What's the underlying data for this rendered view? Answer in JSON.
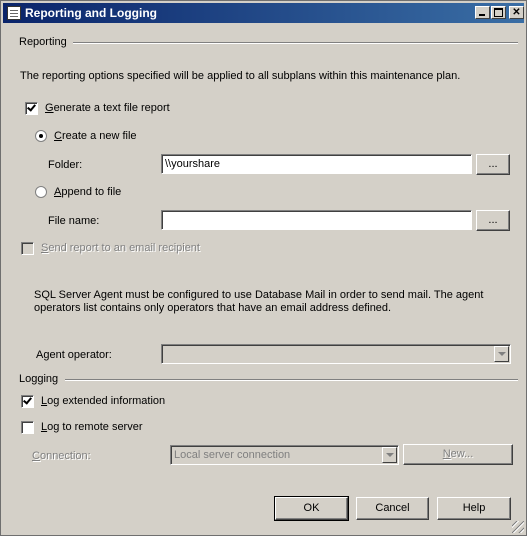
{
  "window": {
    "title": "Reporting and Logging"
  },
  "reporting": {
    "group_label": "Reporting",
    "description": "The reporting options specified will be applied to all subplans within this maintenance plan.",
    "generate_text_report": {
      "label_prefix": "",
      "accel": "G",
      "label_rest": "enerate a text file report",
      "checked": true
    },
    "create_new_file": {
      "accel": "C",
      "label_rest": "reate a new file",
      "selected": true
    },
    "folder": {
      "label": "Folder:",
      "value": "\\\\yourshare",
      "browse": "..."
    },
    "append_to_file": {
      "accel": "A",
      "label_rest": "ppend to file",
      "selected": false
    },
    "file_name": {
      "label": "File name:",
      "value": "",
      "browse": "..."
    },
    "email": {
      "accel": "S",
      "label_rest": "end report to an email recipient",
      "checked": false,
      "enabled": false
    },
    "mail_note_line1": "SQL Server Agent must be configured to use Database Mail in order to send mail. The agent",
    "mail_note_line2": "operators list contains only operators that have an email address defined.",
    "agent_operator": {
      "label": "Agent operator:",
      "value": ""
    }
  },
  "logging": {
    "group_label": "Logging",
    "extended": {
      "accel": "L",
      "label_rest": "og extended information",
      "checked": true
    },
    "remote": {
      "accel": "L",
      "label_rest": "og to remote server",
      "checked": false
    },
    "connection": {
      "accel": "C",
      "label_rest": "onnection:",
      "value": "Local server connection",
      "new_accel": "N",
      "new_rest": "ew..."
    }
  },
  "buttons": {
    "ok": "OK",
    "cancel": "Cancel",
    "help": "Help"
  },
  "icons": [
    "document-icon",
    "minimize-icon",
    "maximize-icon",
    "close-icon",
    "dropdown-arrow-icon",
    "resize-grip-icon"
  ]
}
